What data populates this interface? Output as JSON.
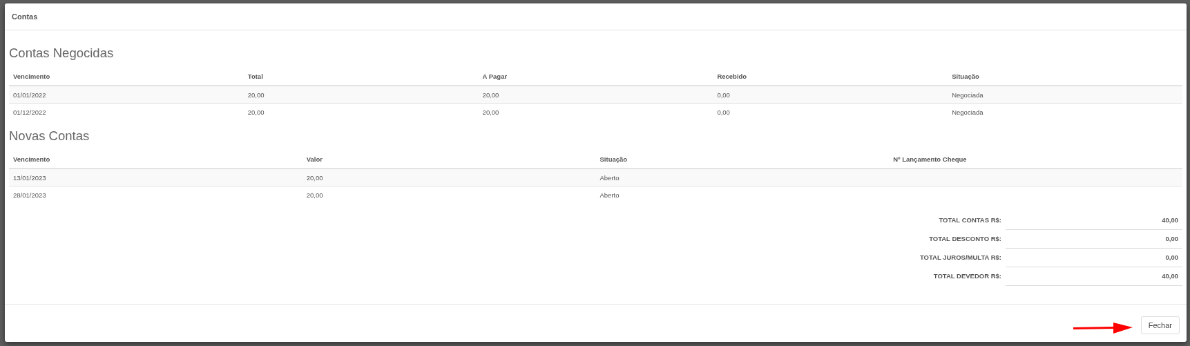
{
  "modal": {
    "title": "Contas"
  },
  "negotiated": {
    "heading": "Contas Negocidas",
    "columns": [
      "Vencimento",
      "Total",
      "A Pagar",
      "Recebido",
      "Situação"
    ],
    "rows": [
      [
        "01/01/2022",
        "20,00",
        "20,00",
        "0,00",
        "Negociada"
      ],
      [
        "01/12/2022",
        "20,00",
        "20,00",
        "0,00",
        "Negociada"
      ]
    ]
  },
  "new_accounts": {
    "heading": "Novas Contas",
    "columns": [
      "Vencimento",
      "Valor",
      "Situação",
      "Nº Lançamento Cheque"
    ],
    "rows": [
      [
        "13/01/2023",
        "20,00",
        "Aberto",
        ""
      ],
      [
        "28/01/2023",
        "20,00",
        "Aberto",
        ""
      ]
    ]
  },
  "totals": [
    {
      "label": "TOTAL CONTAS R$:",
      "value": "40,00"
    },
    {
      "label": "TOTAL DESCONTO R$:",
      "value": "0,00"
    },
    {
      "label": "TOTAL JUROS/MULTA R$:",
      "value": "0,00"
    },
    {
      "label": "TOTAL DEVEDOR R$:",
      "value": "40,00"
    }
  ],
  "footer": {
    "close_button": "Fechar"
  }
}
